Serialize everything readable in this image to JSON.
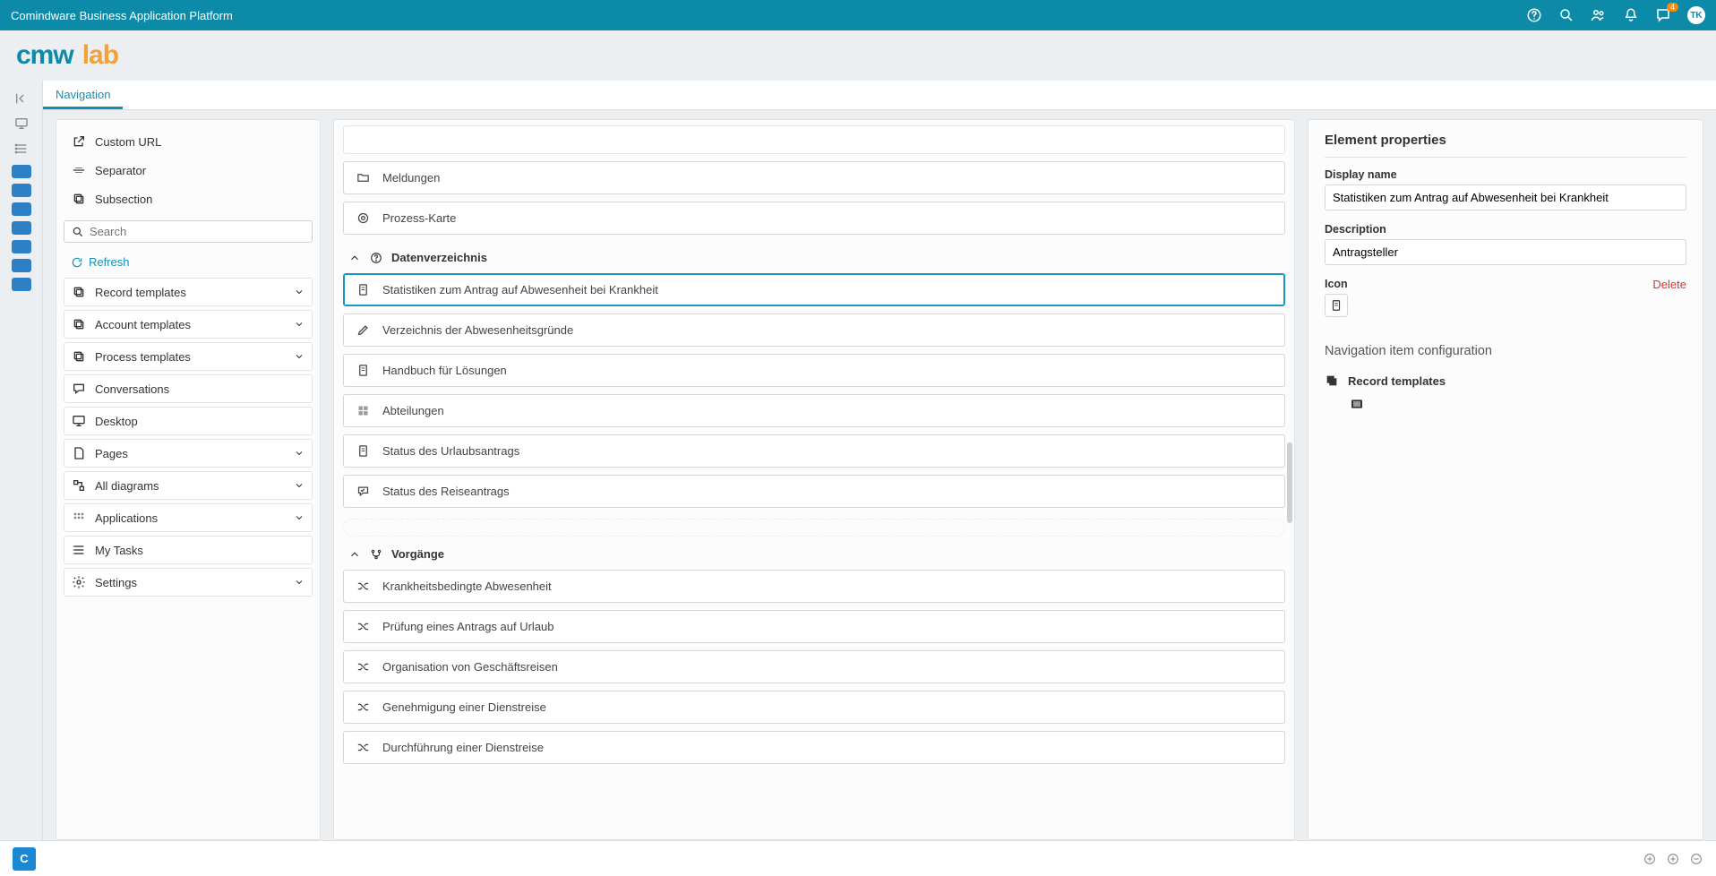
{
  "topbar": {
    "title": "Comindware Business Application Platform",
    "notification_badge": "4",
    "avatar_initials": "TK"
  },
  "brand": {
    "cmw": "cmw",
    "lab": "lab"
  },
  "tab": {
    "label": "Navigation"
  },
  "palette": {
    "custom_url": "Custom URL",
    "separator": "Separator",
    "subsection": "Subsection",
    "search_placeholder": "Search",
    "refresh": "Refresh",
    "cats": {
      "record_templates": "Record templates",
      "account_templates": "Account templates",
      "process_templates": "Process templates",
      "conversations": "Conversations",
      "desktop": "Desktop",
      "pages": "Pages",
      "all_diagrams": "All diagrams",
      "applications": "Applications",
      "my_tasks": "My Tasks",
      "settings": "Settings"
    }
  },
  "nav": {
    "meldungen": "Meldungen",
    "prozess_karte": "Prozess-Karte",
    "section_daten": "Datenverzeichnis",
    "stat_krank": "Statistiken zum Antrag auf Abwesenheit bei Krankheit",
    "verzeichnis_gruende": "Verzeichnis der Abwesenheitsgründe",
    "handbuch": "Handbuch für Lösungen",
    "abteilungen": "Abteilungen",
    "status_urlaub": "Status des Urlaubsantrags",
    "status_reise": "Status des Reiseantrags",
    "section_vorgaenge": "Vorgänge",
    "krankheitsbed": "Krankheitsbedingte Abwesenheit",
    "pruefung_urlaub": "Prüfung eines Antrags auf Urlaub",
    "organisation_reisen": "Organisation von Geschäftsreisen",
    "genehmigung_dienstreise": "Genehmigung einer Dienstreise",
    "durchfuehrung_dienstreise": "Durchführung einer Dienstreise"
  },
  "props": {
    "title": "Element properties",
    "display_name_label": "Display name",
    "display_name_value": "Statistiken zum Antrag auf Abwesenheit bei Krankheit",
    "description_label": "Description",
    "description_value": "Antragsteller",
    "icon_label": "Icon",
    "delete": "Delete",
    "config_head": "Navigation item configuration",
    "record_templates": "Record templates"
  }
}
